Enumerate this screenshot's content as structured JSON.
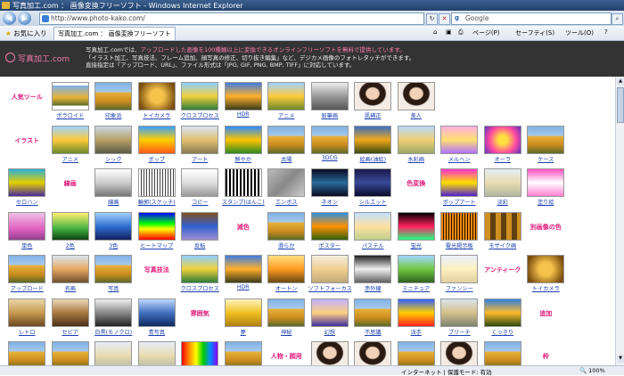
{
  "window": {
    "title": "写真加工.com ： 画像変換フリーソフト - Windows Internet Explorer"
  },
  "address": {
    "url": "http://www.photo-kako.com/",
    "search_placeholder": "Google"
  },
  "favorites": {
    "label": "お気に入り",
    "tab_title": "写真加工.com ： 画像変換フリーソフト"
  },
  "commands": {
    "page": "ページ(P)",
    "safety": "セーフティ(S)",
    "tools": "ツール(O)",
    "help": "?"
  },
  "header": {
    "logo": "写真加工.com",
    "line1_a": "写真加工.comでは、",
    "line1_b": "アップロードした画像を100種類以上に変換できるオンラインフリーソフトを無料で提供しています。",
    "line2": "「イラスト加工、写真技法、フレーム追加、顔写真の修正、切り抜き編集」など、デジカメ画像のフォトレタッチができます。",
    "line3": "直接指定は「アップロード、URL」、ファイル形式は「JPG, GIF, PNG, BMP, TIFF」に対応しています。"
  },
  "grid": [
    {
      "kind": "label",
      "text": "人気ツール"
    },
    {
      "kind": "item",
      "text": "ポラロイド",
      "style": "polaroid"
    },
    {
      "kind": "item",
      "text": "印象派",
      "style": "normal"
    },
    {
      "kind": "item",
      "text": "トイカメラ",
      "style": "toy"
    },
    {
      "kind": "item",
      "text": "クロスプロセス",
      "style": "cross"
    },
    {
      "kind": "item",
      "text": "HDR",
      "style": "hdr"
    },
    {
      "kind": "item",
      "text": "アニメ",
      "style": "anime"
    },
    {
      "kind": "item",
      "text": "鉛筆画",
      "style": "pencil"
    },
    {
      "kind": "item",
      "text": "肌補正",
      "style": "face"
    },
    {
      "kind": "item",
      "text": "美人",
      "style": "face"
    },
    {
      "kind": "empty"
    },
    {
      "kind": "empty"
    },
    {
      "kind": "empty"
    },
    {
      "kind": "empty"
    },
    {
      "kind": "label",
      "text": "イラスト"
    },
    {
      "kind": "item",
      "text": "アニメ",
      "style": "anime"
    },
    {
      "kind": "item",
      "text": "シック",
      "style": "chic"
    },
    {
      "kind": "item",
      "text": "ポップ",
      "style": "pop"
    },
    {
      "kind": "item",
      "text": "アート",
      "style": "art"
    },
    {
      "kind": "item",
      "text": "鮮やか",
      "style": "vivid"
    },
    {
      "kind": "item",
      "text": "太陽",
      "style": "normal"
    },
    {
      "kind": "item",
      "text": "3DCG",
      "style": "normal"
    },
    {
      "kind": "item",
      "text": "絵画(油絵)",
      "style": "oil"
    },
    {
      "kind": "item",
      "text": "水彩画",
      "style": "water"
    },
    {
      "kind": "item",
      "text": "メルヘン",
      "style": "marchen"
    },
    {
      "kind": "item",
      "text": "オーラ",
      "style": "aura"
    },
    {
      "kind": "item",
      "text": "ケース",
      "style": "normal"
    },
    {
      "kind": "empty"
    },
    {
      "kind": "item",
      "text": "セロハン",
      "style": "cello"
    },
    {
      "kind": "label",
      "text": "線画"
    },
    {
      "kind": "item",
      "text": "線画",
      "style": "line"
    },
    {
      "kind": "item",
      "text": "輪郭(スケッチ)",
      "style": "sketch"
    },
    {
      "kind": "item",
      "text": "コピー",
      "style": "copy"
    },
    {
      "kind": "item",
      "text": "スタンプ(はんこ)",
      "style": "stamp"
    },
    {
      "kind": "item",
      "text": "エンボス",
      "style": "emboss"
    },
    {
      "kind": "item",
      "text": "ネオン",
      "style": "neon"
    },
    {
      "kind": "item",
      "text": "シルエット",
      "style": "silhouette"
    },
    {
      "kind": "label",
      "text": "色変換"
    },
    {
      "kind": "item",
      "text": "ポップアート",
      "style": "popart"
    },
    {
      "kind": "item",
      "text": "淡彩",
      "style": "pale"
    },
    {
      "kind": "item",
      "text": "塗り絵",
      "style": "nurie"
    },
    {
      "kind": "empty"
    },
    {
      "kind": "item",
      "text": "単色",
      "style": "mono"
    },
    {
      "kind": "item",
      "text": "2色",
      "style": "two"
    },
    {
      "kind": "item",
      "text": "3色",
      "style": "three"
    },
    {
      "kind": "item",
      "text": "ヒートマップ",
      "style": "heat"
    },
    {
      "kind": "item",
      "text": "反転",
      "style": "invert"
    },
    {
      "kind": "label",
      "text": "減色"
    },
    {
      "kind": "item",
      "text": "滑らか",
      "style": "normal"
    },
    {
      "kind": "item",
      "text": "ポスター",
      "style": "poster"
    },
    {
      "kind": "item",
      "text": "パステル",
      "style": "pastel"
    },
    {
      "kind": "item",
      "text": "蛍光",
      "style": "fluor"
    },
    {
      "kind": "item",
      "text": "電光掲示板",
      "style": "led"
    },
    {
      "kind": "item",
      "text": "モザイク画",
      "style": "mosaic"
    },
    {
      "kind": "label",
      "text": "別画像の色"
    },
    {
      "kind": "empty"
    },
    {
      "kind": "item",
      "text": "アップロード",
      "style": "normal"
    },
    {
      "kind": "item",
      "text": "名画",
      "style": "master"
    },
    {
      "kind": "item",
      "text": "写真",
      "style": "normal"
    },
    {
      "kind": "label",
      "text": "写真技法"
    },
    {
      "kind": "item",
      "text": "クロスプロセス",
      "style": "cross"
    },
    {
      "kind": "item",
      "text": "HDR",
      "style": "hdr"
    },
    {
      "kind": "item",
      "text": "オートン",
      "style": "orton"
    },
    {
      "kind": "item",
      "text": "ソフトフォーカス",
      "style": "soft"
    },
    {
      "kind": "item",
      "text": "赤外線",
      "style": "ir"
    },
    {
      "kind": "item",
      "text": "ミニチュア",
      "style": "mini"
    },
    {
      "kind": "item",
      "text": "ファンシー",
      "style": "fancy"
    },
    {
      "kind": "label",
      "text": "アンティーク"
    },
    {
      "kind": "item",
      "text": "トイカメラ",
      "style": "toy"
    },
    {
      "kind": "empty"
    },
    {
      "kind": "item",
      "text": "レトロ",
      "style": "retro"
    },
    {
      "kind": "item",
      "text": "セピア",
      "style": "sepia"
    },
    {
      "kind": "item",
      "text": "白黒(モノクロ)",
      "style": "bw"
    },
    {
      "kind": "item",
      "text": "青写真",
      "style": "blue"
    },
    {
      "kind": "label",
      "text": "雰囲気"
    },
    {
      "kind": "item",
      "text": "夢",
      "style": "dream"
    },
    {
      "kind": "item",
      "text": "神秘",
      "style": "normal"
    },
    {
      "kind": "item",
      "text": "幻想",
      "style": "fantasy"
    },
    {
      "kind": "item",
      "text": "不思議",
      "style": "normal"
    },
    {
      "kind": "item",
      "text": "派手",
      "style": "flashy"
    },
    {
      "kind": "item",
      "text": "ブリーチ",
      "style": "bleach"
    },
    {
      "kind": "item",
      "text": "くっきり",
      "style": "sharp"
    },
    {
      "kind": "label",
      "text": "追加"
    },
    {
      "kind": "empty"
    },
    {
      "kind": "item",
      "text": "",
      "style": "normal"
    },
    {
      "kind": "item",
      "text": "",
      "style": "normal"
    },
    {
      "kind": "item",
      "text": "",
      "style": "pale"
    },
    {
      "kind": "item",
      "text": "",
      "style": "pale"
    },
    {
      "kind": "item",
      "text": "",
      "style": "rainbow"
    },
    {
      "kind": "item",
      "text": "",
      "style": "normal"
    },
    {
      "kind": "label",
      "text": "人物・顔用"
    },
    {
      "kind": "item",
      "text": "",
      "style": "face"
    },
    {
      "kind": "item",
      "text": "",
      "style": "face"
    },
    {
      "kind": "item",
      "text": "",
      "style": "normal"
    },
    {
      "kind": "item",
      "text": "",
      "style": "face"
    },
    {
      "kind": "item",
      "text": "",
      "style": "normal"
    },
    {
      "kind": "label",
      "text": "枠"
    },
    {
      "kind": "empty"
    }
  ],
  "status": {
    "zone": "インターネット | 保護モード: 有効",
    "zoom": "100%"
  }
}
